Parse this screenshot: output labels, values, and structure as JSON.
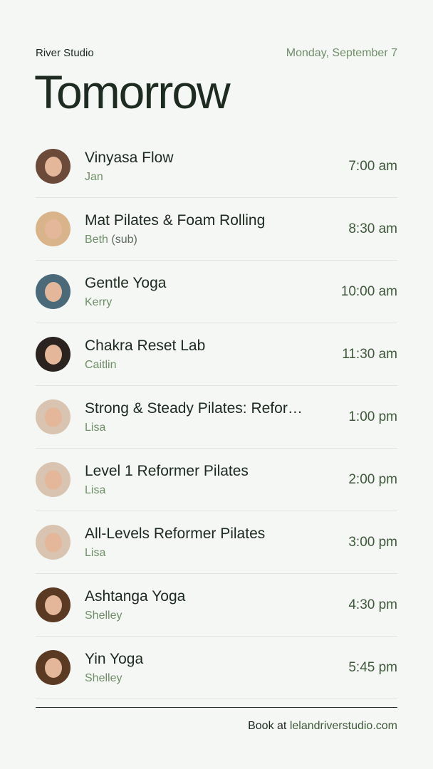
{
  "studio_name": "River Studio",
  "date": "Monday, September 7",
  "title": "Tomorrow",
  "classes": [
    {
      "name": "Vinyasa Flow",
      "instructor": "Jan",
      "note": "",
      "time": "7:00 am",
      "avatar_color": "#6b4a3a"
    },
    {
      "name": "Mat Pilates & Foam Rolling",
      "instructor": "Beth",
      "note": "(sub)",
      "time": "8:30 am",
      "avatar_color": "#d9b48a"
    },
    {
      "name": "Gentle Yoga",
      "instructor": "Kerry",
      "note": "",
      "time": "10:00 am",
      "avatar_color": "#4a6a7a"
    },
    {
      "name": "Chakra Reset Lab",
      "instructor": "Caitlin",
      "note": "",
      "time": "11:30 am",
      "avatar_color": "#2a2320"
    },
    {
      "name": "Strong & Steady Pilates: Refor…",
      "instructor": "Lisa",
      "note": "",
      "time": "1:00 pm",
      "avatar_color": "#d8c4b0"
    },
    {
      "name": "Level 1 Reformer Pilates",
      "instructor": "Lisa",
      "note": "",
      "time": "2:00 pm",
      "avatar_color": "#d8c4b0"
    },
    {
      "name": "All-Levels Reformer Pilates",
      "instructor": "Lisa",
      "note": "",
      "time": "3:00 pm",
      "avatar_color": "#d8c4b0"
    },
    {
      "name": "Ashtanga Yoga",
      "instructor": "Shelley",
      "note": "",
      "time": "4:30 pm",
      "avatar_color": "#5a3a22"
    },
    {
      "name": "Yin Yoga",
      "instructor": "Shelley",
      "note": "",
      "time": "5:45 pm",
      "avatar_color": "#5a3a22"
    }
  ],
  "footer": {
    "prefix": "Book at",
    "link": "lelandriverstudio.com"
  }
}
